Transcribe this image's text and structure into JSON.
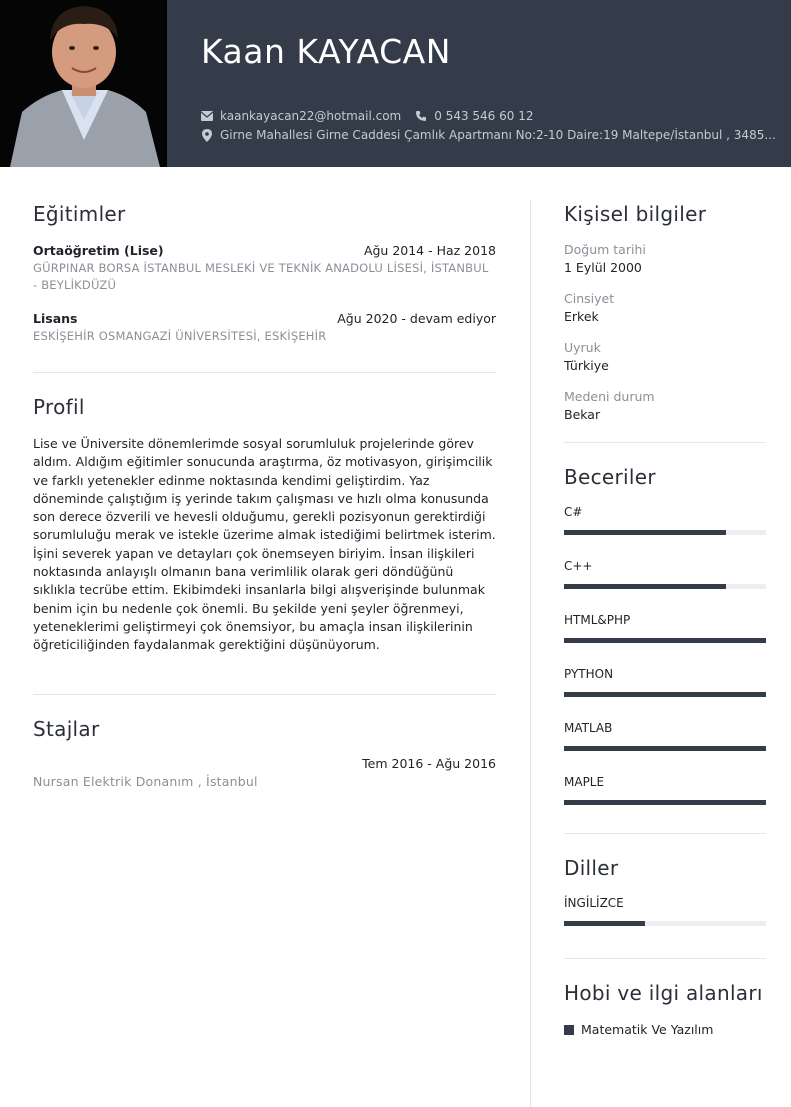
{
  "header": {
    "name": "Kaan KAYACAN",
    "email": "kaankayacan22@hotmail.com",
    "phone": "0 543 546 60 12",
    "address": "Girne Mahallesi Girne Caddesi Çamlık Apartmanı No:2-10 Daire:19 Maltepe/İstanbul , 3485..."
  },
  "education": {
    "title": "Eğitimler",
    "items": [
      {
        "degree": "Ortaöğretim (Lise)",
        "dates": "Ağu 2014 - Haz 2018",
        "school": "GÜRPINAR BORSA İSTANBUL MESLEKİ VE TEKNİK ANADOLU LİSESİ, İSTANBUL - BEYLİKDÜZÜ"
      },
      {
        "degree": "Lisans",
        "dates": "Ağu 2020 - devam ediyor",
        "school": "ESKİŞEHİR OSMANGAZİ ÜNİVERSİTESİ, ESKİŞEHİR"
      }
    ]
  },
  "profile": {
    "title": "Profil",
    "text": "Lise ve Üniversite dönemlerimde sosyal sorumluluk projelerinde görev aldım. Aldığım eğitimler sonucunda araştırma, öz motivasyon, girişimcilik ve farklı yetenekler edinme noktasında kendimi geliştirdim. Yaz döneminde çalıştığım iş yerinde takım çalışması ve hızlı olma konusunda son derece özverili ve hevesli olduğumu, gerekli pozisyonun gerektirdiği sorumluluğu merak ve istekle üzerime almak istediğimi belirtmek isterim. İşini severek yapan ve detayları çok önemseyen biriyim. İnsan ilişkileri noktasında anlayışlı olmanın bana verimlilik olarak geri döndüğünü sıklıkla tecrübe ettim. Ekibimdeki insanlarla bilgi alışverişinde bulunmak benim için bu nedenle çok önemli. Bu şekilde yeni şeyler öğrenmeyi, yeteneklerimi geliştirmeyi çok önemsiyor, bu amaçla insan ilişkilerinin öğreticiliğinden faydalanmak gerektiğini düşünüyorum."
  },
  "internships": {
    "title": "Stajlar",
    "items": [
      {
        "dates": "Tem 2016 - Ağu 2016",
        "place": "Nursan Elektrik Donanım , İstanbul"
      }
    ]
  },
  "personal": {
    "title": "Kişisel bilgiler",
    "fields": [
      {
        "label": "Doğum tarihi",
        "value": "1 Eylül 2000"
      },
      {
        "label": "Cinsiyet",
        "value": "Erkek"
      },
      {
        "label": "Uyruk",
        "value": "Türkiye"
      },
      {
        "label": "Medeni durum",
        "value": "Bekar"
      }
    ]
  },
  "skills": {
    "title": "Beceriler",
    "items": [
      {
        "name": "C#",
        "level": 0.8
      },
      {
        "name": "C++",
        "level": 0.8
      },
      {
        "name": "HTML&PHP",
        "level": 1.0
      },
      {
        "name": "PYTHON",
        "level": 1.0
      },
      {
        "name": "MATLAB",
        "level": 1.0
      },
      {
        "name": "MAPLE",
        "level": 1.0
      }
    ]
  },
  "languages": {
    "title": "Diller",
    "items": [
      {
        "name": "İNGİLİZCE",
        "level": 0.4
      }
    ]
  },
  "hobbies": {
    "title": "Hobi ve ilgi alanları",
    "items": [
      "Matematik Ve Yazılım"
    ]
  },
  "colors": {
    "header_bg": "#343b49",
    "bar_fill": "#343b49",
    "bar_track": "#eceef1",
    "muted_text": "#8a8f98"
  }
}
